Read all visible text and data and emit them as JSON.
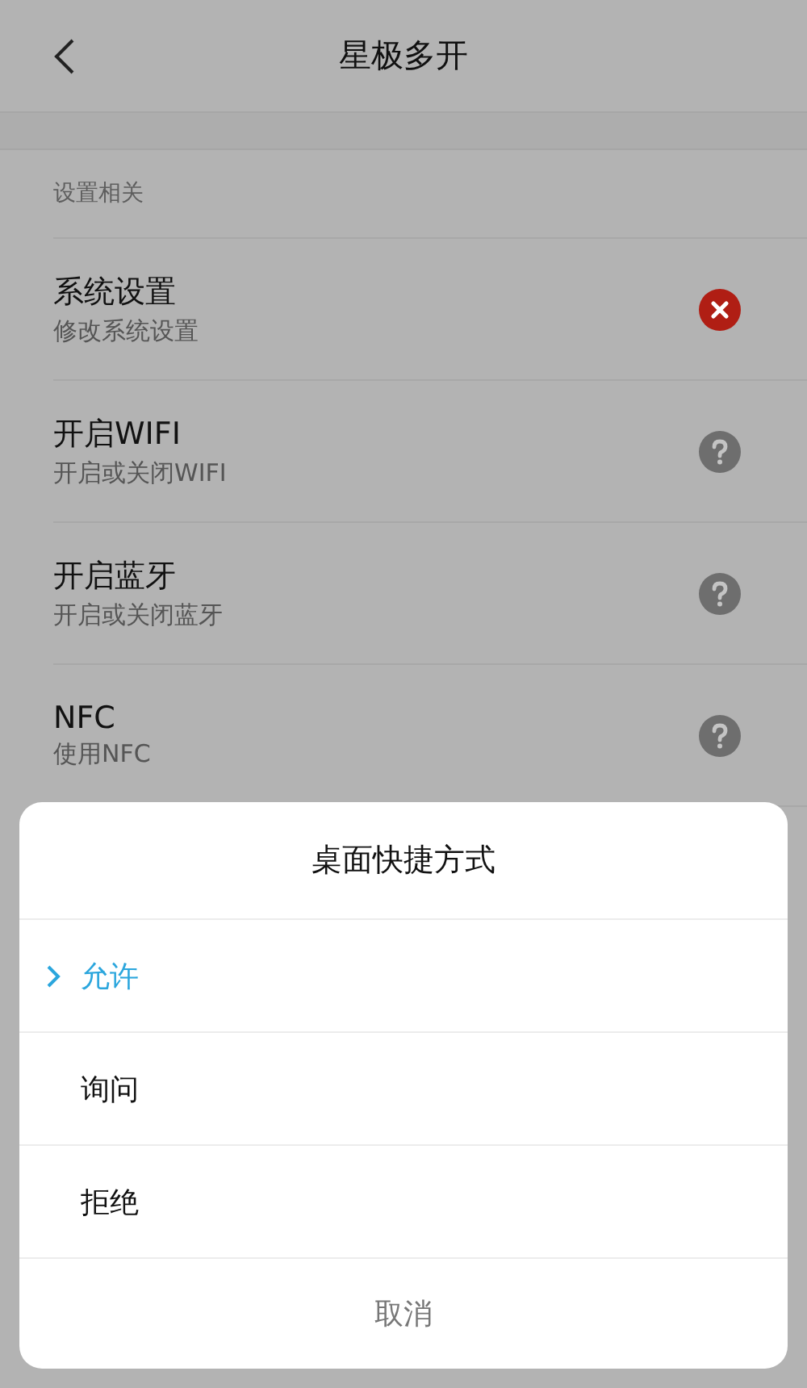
{
  "header": {
    "title": "星极多开"
  },
  "section": {
    "title": "设置相关"
  },
  "settings": [
    {
      "title": "系统设置",
      "subtitle": "修改系统设置",
      "kind": "denied"
    },
    {
      "title": "开启WIFI",
      "subtitle": "开启或关闭WIFI",
      "kind": "ask"
    },
    {
      "title": "开启蓝牙",
      "subtitle": "开启或关闭蓝牙",
      "kind": "ask"
    },
    {
      "title": "NFC",
      "subtitle": "使用NFC",
      "kind": "ask"
    }
  ],
  "dialog": {
    "title": "桌面快捷方式",
    "options": [
      {
        "label": "允许",
        "selected": true
      },
      {
        "label": "询问",
        "selected": false
      },
      {
        "label": "拒绝",
        "selected": false
      }
    ],
    "cancel": "取消"
  }
}
